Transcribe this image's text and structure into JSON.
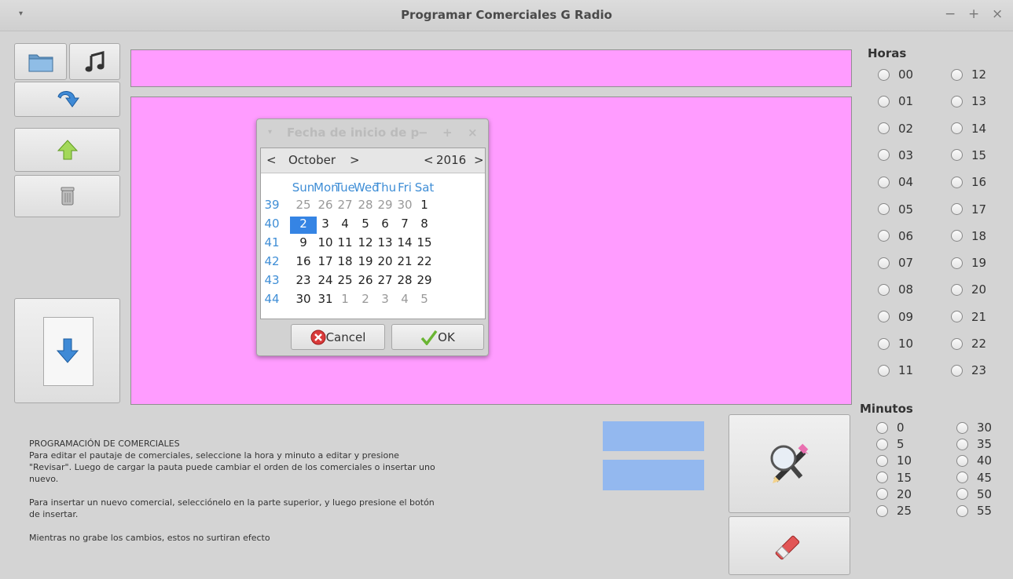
{
  "window": {
    "title": "Programar Comerciales G Radio",
    "menu_glyph": "▾",
    "minimize": "−",
    "maximize": "+",
    "close": "×"
  },
  "info": {
    "heading": "PROGRAMACIÓN DE COMERCIALES",
    "para1": "Para editar el pautaje de comerciales, seleccione la hora y minuto a editar y presione \"Revisar\". Luego de cargar la pauta puede cambiar el orden de los comerciales o insertar uno nuevo.",
    "para2": "Para insertar un nuevo comercial, selecciónelo en la parte superior, y luego presione el botón de insertar.",
    "para3": "Mientras no grabe los cambios, estos no surtiran efecto"
  },
  "horas": {
    "label": "Horas",
    "left": [
      "00",
      "01",
      "02",
      "03",
      "04",
      "05",
      "06",
      "07",
      "08",
      "09",
      "10",
      "11"
    ],
    "right": [
      "12",
      "13",
      "14",
      "15",
      "16",
      "17",
      "18",
      "19",
      "20",
      "21",
      "22",
      "23"
    ]
  },
  "minutos": {
    "label": "Minutos",
    "left": [
      "0",
      "5",
      "10",
      "15",
      "20",
      "25"
    ],
    "right": [
      "30",
      "35",
      "40",
      "45",
      "50",
      "55"
    ]
  },
  "dialog": {
    "title": "Fecha de inicio de p",
    "minimize": "−",
    "maximize": "+",
    "close": "×",
    "prev": "<",
    "next": ">",
    "month": "October",
    "year": "2016",
    "weekdays": [
      "Sun",
      "Mon",
      "Tue",
      "Wed",
      "Thu",
      "Fri",
      "Sat"
    ],
    "weeks": [
      {
        "num": "39",
        "days": [
          "25",
          "26",
          "27",
          "28",
          "29",
          "30",
          "1"
        ],
        "other": [
          true,
          true,
          true,
          true,
          true,
          true,
          false
        ]
      },
      {
        "num": "40",
        "days": [
          "2",
          "3",
          "4",
          "5",
          "6",
          "7",
          "8"
        ],
        "other": [
          false,
          false,
          false,
          false,
          false,
          false,
          false
        ]
      },
      {
        "num": "41",
        "days": [
          "9",
          "10",
          "11",
          "12",
          "13",
          "14",
          "15"
        ],
        "other": [
          false,
          false,
          false,
          false,
          false,
          false,
          false
        ]
      },
      {
        "num": "42",
        "days": [
          "16",
          "17",
          "18",
          "19",
          "20",
          "21",
          "22"
        ],
        "other": [
          false,
          false,
          false,
          false,
          false,
          false,
          false
        ]
      },
      {
        "num": "43",
        "days": [
          "23",
          "24",
          "25",
          "26",
          "27",
          "28",
          "29"
        ],
        "other": [
          false,
          false,
          false,
          false,
          false,
          false,
          false
        ]
      },
      {
        "num": "44",
        "days": [
          "30",
          "31",
          "1",
          "2",
          "3",
          "4",
          "5"
        ],
        "other": [
          false,
          false,
          true,
          true,
          true,
          true,
          true
        ]
      }
    ],
    "selected_day": "2",
    "cancel_label": "Cancel",
    "ok_label": "OK"
  },
  "colors": {
    "pink": "#ff9cff",
    "blue": "#93b8ef",
    "accent": "#3584e4",
    "weekday_blue": "#3f8ed6"
  }
}
